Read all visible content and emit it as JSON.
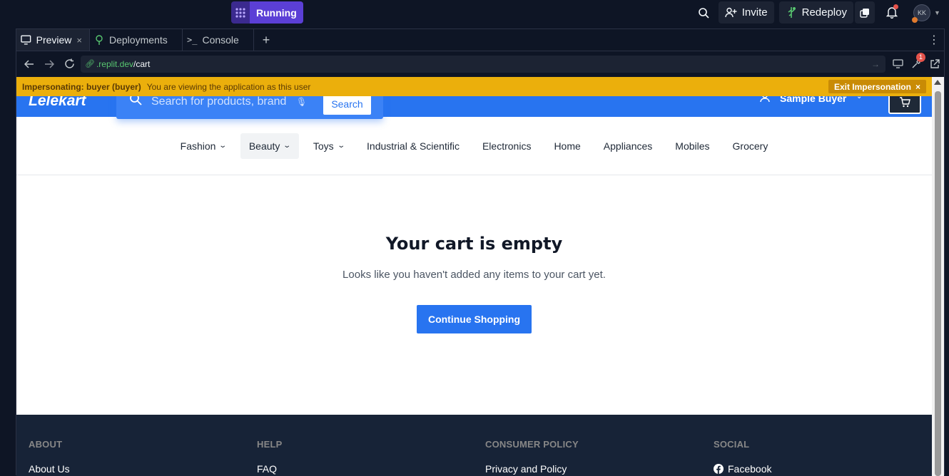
{
  "topbar": {
    "run_label": "Running",
    "invite_label": "Invite",
    "redeploy_label": "Redeploy",
    "avatar_initials": "KK"
  },
  "tabs": [
    {
      "label": "Preview",
      "close": "×"
    },
    {
      "label": "Deployments"
    },
    {
      "label": "Console"
    }
  ],
  "tab_add": "+",
  "urlbar": {
    "domain": ".replit.dev",
    "path": "/cart",
    "devtools_badge": "1"
  },
  "impersonation": {
    "label": "Impersonating: buyer (buyer)",
    "message": "You are viewing the application as this user",
    "exit_label": "Exit Impersonation",
    "exit_icon": "×"
  },
  "site": {
    "logo": "Lelekart",
    "search_placeholder": "Search for products, brands",
    "search_button": "Search",
    "user_name": "Sample Buyer"
  },
  "categories": [
    {
      "label": "Fashion",
      "dropdown": true
    },
    {
      "label": "Beauty",
      "dropdown": true
    },
    {
      "label": "Toys",
      "dropdown": true
    },
    {
      "label": "Industrial & Scientific",
      "dropdown": false
    },
    {
      "label": "Electronics",
      "dropdown": false
    },
    {
      "label": "Home",
      "dropdown": false
    },
    {
      "label": "Appliances",
      "dropdown": false
    },
    {
      "label": "Mobiles",
      "dropdown": false
    },
    {
      "label": "Grocery",
      "dropdown": false
    }
  ],
  "cart": {
    "title": "Your cart is empty",
    "message": "Looks like you haven't added any items to your cart yet.",
    "button": "Continue Shopping"
  },
  "footer": {
    "columns": [
      {
        "heading": "ABOUT",
        "link": "About Us"
      },
      {
        "heading": "HELP",
        "link": "FAQ"
      },
      {
        "heading": "CONSUMER POLICY",
        "link": "Privacy and Policy"
      },
      {
        "heading": "SOCIAL",
        "link": "Facebook"
      }
    ]
  },
  "colors": {
    "brand_blue": "#2874f0",
    "impersonation_bar": "#ebaf0c",
    "run_purple": "#5b3fd6",
    "footer_bg": "#172337"
  }
}
